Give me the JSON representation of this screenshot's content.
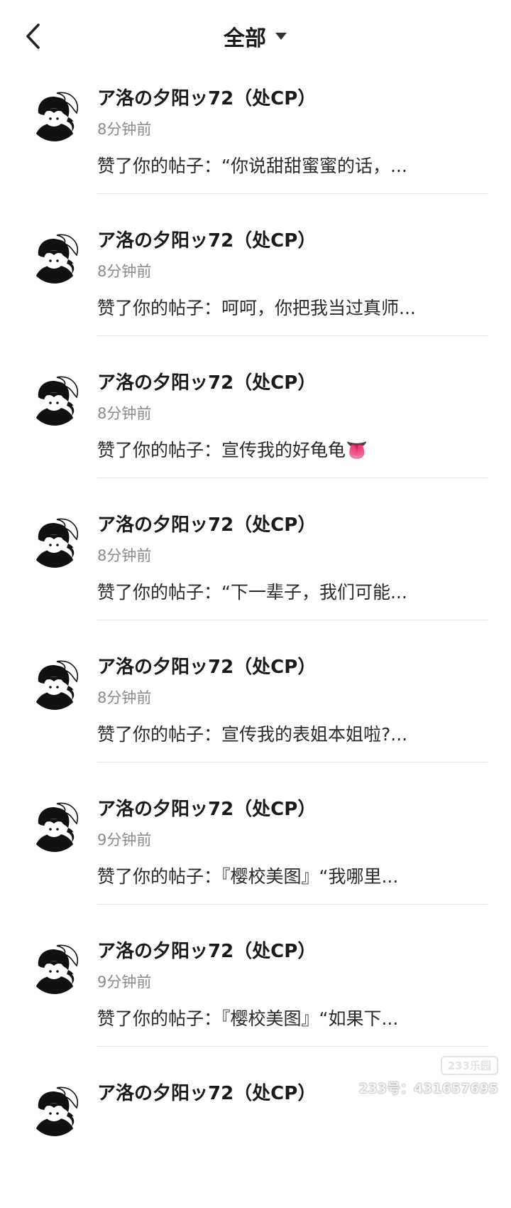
{
  "header": {
    "title": "全部",
    "back_icon": "chevron-left-icon",
    "dropdown_icon": "caret-down-icon"
  },
  "notifications": [
    {
      "name": "ア洛の夕阳ッ72（处CP）",
      "time": "8分钟前",
      "message": "赞了你的帖子：“你说甜甜蜜蜜的话，..."
    },
    {
      "name": "ア洛の夕阳ッ72（处CP）",
      "time": "8分钟前",
      "message": "赞了你的帖子：呵呵，你把我当过真师..."
    },
    {
      "name": "ア洛の夕阳ッ72（处CP）",
      "time": "8分钟前",
      "message": "赞了你的帖子：宣传我的好龟龟👅"
    },
    {
      "name": "ア洛の夕阳ッ72（处CP）",
      "time": "8分钟前",
      "message": "赞了你的帖子：“下一辈子，我们可能..."
    },
    {
      "name": "ア洛の夕阳ッ72（处CP）",
      "time": "8分钟前",
      "message": "赞了你的帖子：宣传我的表姐本姐啦?..."
    },
    {
      "name": "ア洛の夕阳ッ72（处CP）",
      "time": "9分钟前",
      "message": "赞了你的帖子：『樱校美图』“我哪里..."
    },
    {
      "name": "ア洛の夕阳ッ72（处CP）",
      "time": "9分钟前",
      "message": "赞了你的帖子：『樱校美图』“如果下..."
    },
    {
      "name": "ア洛の夕阳ッ72（处CP）",
      "time": "",
      "message": ""
    }
  ],
  "watermark": {
    "logo": "233乐园",
    "id": "233号：431657695"
  },
  "colors": {
    "background": "#ffffff",
    "text_primary": "#1a1a1a",
    "text_secondary": "#8a8a8a",
    "divider": "#e6e6e6"
  }
}
